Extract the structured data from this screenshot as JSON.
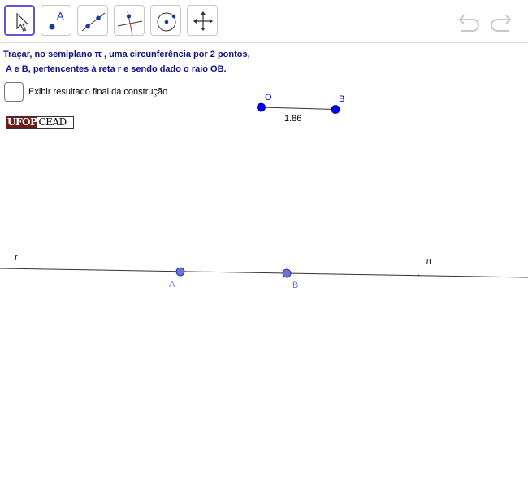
{
  "toolbar": {
    "tools": [
      {
        "name": "move-tool"
      },
      {
        "name": "point-tool",
        "label": "A"
      },
      {
        "name": "line-tool"
      },
      {
        "name": "perpendicular-line-tool"
      },
      {
        "name": "circle-tool"
      },
      {
        "name": "move-graphics-view-tool"
      }
    ],
    "selected_color": "#6557d2",
    "undo_icon": "undo-icon",
    "redo_icon": "redo-icon"
  },
  "statement": {
    "line1": "Traçar, no semiplano  π , uma circunferência por 2 pontos,",
    "line2": "A e B, pertencentes à reta r e sendo dado o raio OB."
  },
  "checkbox": {
    "label": "Exibir resultado final da construção",
    "checked": false
  },
  "logo": {
    "part1": "UFOP",
    "part2": "CEAD"
  },
  "construction": {
    "radius_segment": {
      "start_label": "O",
      "end_label": "B",
      "length_label": "1.86",
      "point_color": "#0000ff"
    },
    "line_label": "r",
    "half_plane_label": "π",
    "points_on_line": [
      {
        "label": "A",
        "color": "#6b72e0"
      },
      {
        "label": "B",
        "color": "#6b72e0"
      }
    ]
  }
}
